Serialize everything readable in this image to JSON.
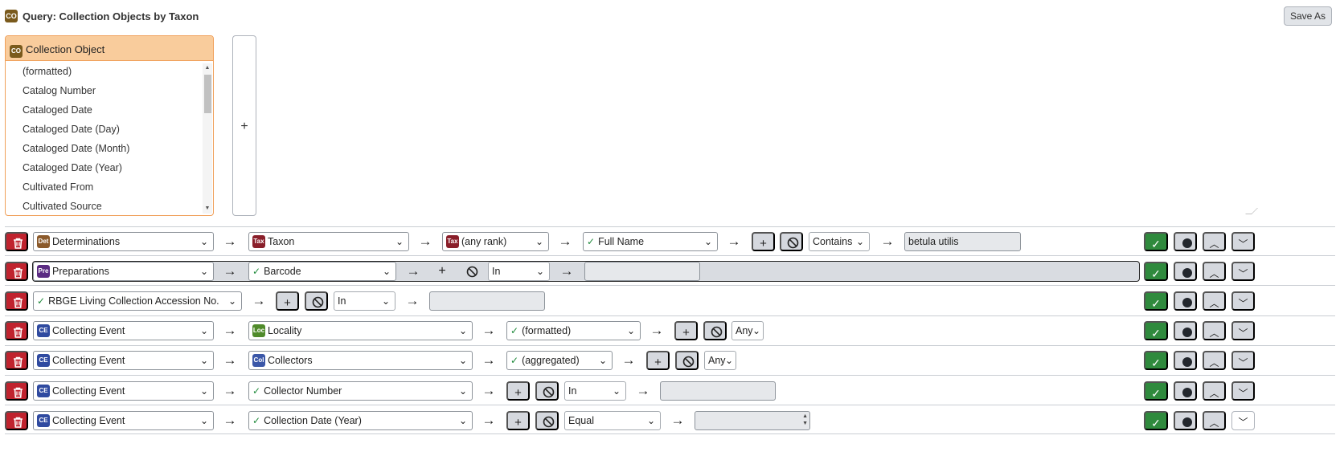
{
  "header": {
    "title": "Query: Collection Objects by Taxon",
    "save_as": "Save As",
    "logo": "CO"
  },
  "picker": {
    "table_icon": "CO",
    "table_label": "Collection Object",
    "items": [
      "(formatted)",
      "Catalog Number",
      "Cataloged Date",
      "Cataloged Date (Day)",
      "Cataloged Date (Month)",
      "Cataloged Date (Year)",
      "Cultivated From",
      "Cultivated Source"
    ]
  },
  "add_column_label": "+",
  "icons": {
    "table_icons": {
      "Det": "#8b5a2b",
      "Tax": "#8a1f2a",
      "Pre": "#5a2b82",
      "CE": "#2f4aa0",
      "Loc": "#4f8a2a",
      "Col": "#3b57a8"
    },
    "check": "check-icon",
    "delete": "trash-icon"
  },
  "colors": {
    "delete": "#c0232e",
    "ok": "#2f8a3d",
    "picker_head": "#f9cc9c"
  },
  "rows": [
    {
      "path": [
        {
          "icon": "Det",
          "label": "Determinations"
        },
        {
          "icon": "Tax",
          "label": "Taxon"
        },
        {
          "icon": "Tax",
          "label": "(any rank)"
        },
        {
          "check": true,
          "label": "Full Name"
        }
      ],
      "op": "Contains",
      "value": "betula utilis"
    },
    {
      "path": [
        {
          "icon": "Pre",
          "label": "Preparations"
        },
        {
          "check": true,
          "label": "Barcode"
        }
      ],
      "op": "In",
      "value": ""
    },
    {
      "path": [
        {
          "check": true,
          "label": "RBGE Living Collection Accession No."
        }
      ],
      "op": "In",
      "value": ""
    },
    {
      "path": [
        {
          "icon": "CE",
          "label": "Collecting Event"
        },
        {
          "icon": "Loc",
          "label": "Locality"
        },
        {
          "check": true,
          "label": "(formatted)"
        }
      ],
      "op": "Any",
      "value": ""
    },
    {
      "path": [
        {
          "icon": "CE",
          "label": "Collecting Event"
        },
        {
          "icon": "Col",
          "label": "Collectors"
        },
        {
          "check": true,
          "label": "(aggregated)"
        }
      ],
      "op": "Any",
      "value": ""
    },
    {
      "path": [
        {
          "icon": "CE",
          "label": "Collecting Event"
        },
        {
          "check": true,
          "label": "Collector Number"
        }
      ],
      "op": "In",
      "value": ""
    },
    {
      "path": [
        {
          "icon": "CE",
          "label": "Collecting Event"
        },
        {
          "check": true,
          "label": "Collection Date (Year)"
        }
      ],
      "op": "Equal",
      "value": ""
    }
  ]
}
